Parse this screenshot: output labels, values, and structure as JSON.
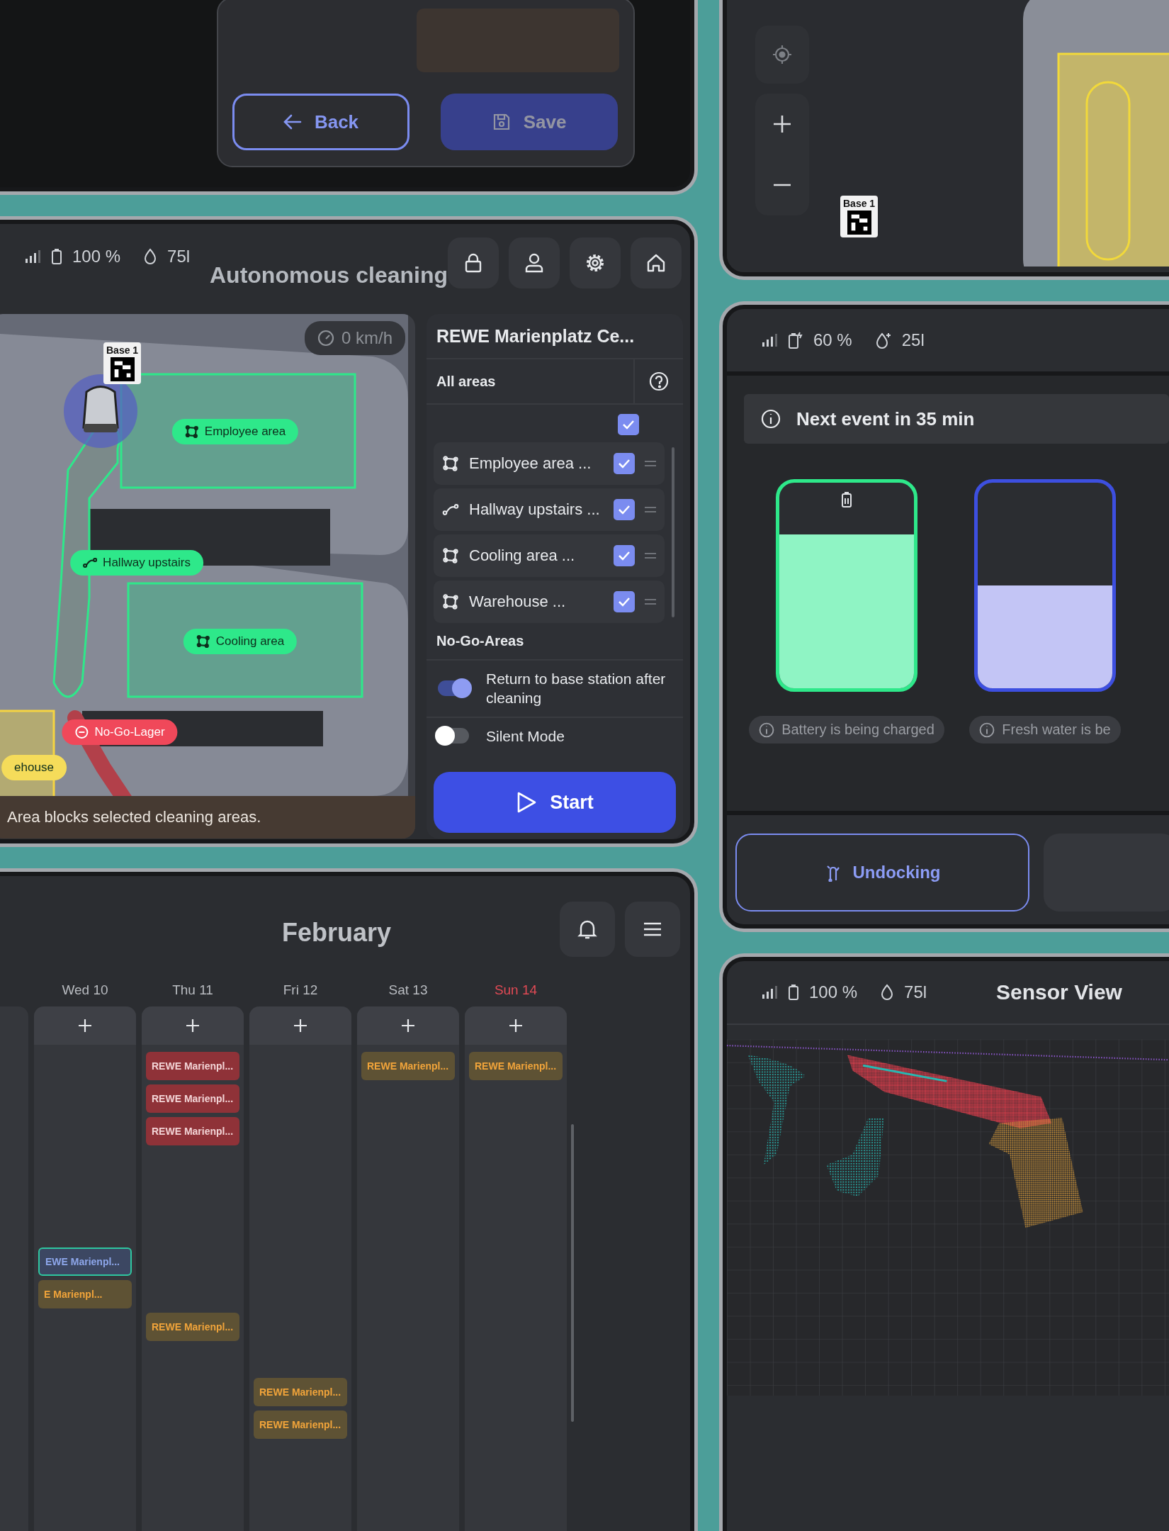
{
  "dialog": {
    "buttons": [
      {
        "label": "Back",
        "kind": "outline",
        "disabled": false
      },
      {
        "label": "Save",
        "kind": "primary",
        "disabled": true
      }
    ]
  },
  "map_view": {
    "base_label": "Base 1"
  },
  "cleaning": {
    "status": {
      "battery": "100 %",
      "water": "75l"
    },
    "title": "Autonomous cleaning",
    "speed": "0 km/h",
    "base_label": "Base 1",
    "map_labels": [
      {
        "label": "Employee area",
        "kind": "area",
        "color": "#2ee88a"
      },
      {
        "label": "Hallway upstairs",
        "kind": "route",
        "color": "#2ee88a"
      },
      {
        "label": "Cooling area",
        "kind": "area",
        "color": "#2ee88a"
      },
      {
        "label": "No-Go-Lager",
        "kind": "nogo",
        "color": "#f0485a"
      },
      {
        "label": "ehouse",
        "kind": "plain",
        "color": "#f5dc5a"
      }
    ],
    "info": "Area blocks selected cleaning areas.",
    "panel": {
      "location": "REWE Marienplatz Ce...",
      "group": "All areas",
      "group_checked": true,
      "areas": [
        {
          "name": "Employee area ...",
          "kind": "area",
          "checked": true
        },
        {
          "name": "Hallway upstairs ...",
          "kind": "route",
          "checked": true
        },
        {
          "name": "Cooling area ...",
          "kind": "area",
          "checked": true
        },
        {
          "name": "Warehouse ...",
          "kind": "area",
          "checked": true
        }
      ],
      "nogo_title": "No-Go-Areas",
      "toggles": [
        {
          "label": "Return to base station after cleaning",
          "on": true
        },
        {
          "label": "Silent Mode",
          "on": false
        }
      ],
      "start": "Start"
    }
  },
  "calendar": {
    "title": "February",
    "days": [
      {
        "label": "Wed 10",
        "highlight": false,
        "events": [
          {
            "kind": "free"
          },
          {
            "kind": "free"
          },
          {
            "kind": "free"
          },
          {
            "kind": "free"
          },
          {
            "kind": "free"
          },
          {
            "kind": "free"
          },
          {
            "label": "EWE Marienpl...",
            "kind": "selected"
          },
          {
            "label": "E Marienpl...",
            "kind": "scheduled"
          }
        ]
      },
      {
        "label": "Thu 11",
        "highlight": false,
        "events": [
          {
            "label": "REWE Marienpl...",
            "kind": "alert"
          },
          {
            "label": "REWE Marienpl...",
            "kind": "alert"
          },
          {
            "label": "REWE Marienpl...",
            "kind": "alert"
          },
          {
            "kind": "free"
          },
          {
            "kind": "free"
          },
          {
            "kind": "free"
          },
          {
            "kind": "free"
          },
          {
            "kind": "free"
          },
          {
            "label": "REWE Marienpl...",
            "kind": "scheduled"
          }
        ]
      },
      {
        "label": "Fri 12",
        "highlight": false,
        "events": [
          {
            "kind": "free"
          },
          {
            "kind": "free"
          },
          {
            "kind": "free"
          },
          {
            "kind": "free"
          },
          {
            "kind": "free"
          },
          {
            "kind": "free"
          },
          {
            "kind": "free"
          },
          {
            "kind": "free"
          },
          {
            "kind": "free"
          },
          {
            "kind": "free"
          },
          {
            "label": "REWE Marienpl...",
            "kind": "scheduled"
          },
          {
            "label": "REWE Marienpl...",
            "kind": "scheduled"
          }
        ]
      },
      {
        "label": "Sat 13",
        "highlight": false,
        "events": [
          {
            "label": "REWE Marienpl...",
            "kind": "scheduled"
          }
        ]
      },
      {
        "label": "Sun 14",
        "highlight": true,
        "events": [
          {
            "label": "REWE Marienpl...",
            "kind": "scheduled"
          }
        ]
      }
    ]
  },
  "charging": {
    "status": {
      "battery": "60 %",
      "water": "25l"
    },
    "notice": "Next event in 35 min",
    "tanks": [
      {
        "kind": "battery",
        "level": 0.75,
        "caption": "Battery is being charged"
      },
      {
        "kind": "water",
        "level": 0.5,
        "caption": "Fresh water is be"
      }
    ],
    "undock": "Undocking"
  },
  "sensor": {
    "status": {
      "battery": "100 %",
      "water": "75l"
    },
    "title": "Sensor View"
  }
}
